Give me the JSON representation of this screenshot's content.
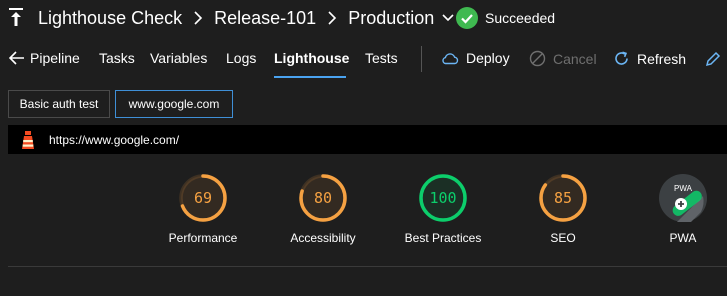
{
  "header": {
    "crumbs": [
      "Lighthouse Check",
      "Release-101",
      "Production"
    ],
    "status": "Succeeded",
    "status_color": "#3fb950"
  },
  "nav": {
    "tabs": [
      {
        "label": "Pipeline",
        "active": false
      },
      {
        "label": "Tasks",
        "active": false
      },
      {
        "label": "Variables",
        "active": false
      },
      {
        "label": "Logs",
        "active": false
      },
      {
        "label": "Lighthouse",
        "active": true
      },
      {
        "label": "Tests",
        "active": false
      }
    ],
    "actions": {
      "deploy": "Deploy",
      "cancel": "Cancel",
      "refresh": "Refresh"
    },
    "accent": "#4aa3f0"
  },
  "subtabs": [
    {
      "label": "Basic auth test",
      "active": false
    },
    {
      "label": "www.google.com",
      "active": true
    }
  ],
  "report": {
    "url": "https://www.google.com/",
    "scores": [
      {
        "label": "Performance",
        "value": "69",
        "fraction": 0.69,
        "color": "#f5a142"
      },
      {
        "label": "Accessibility",
        "value": "80",
        "fraction": 0.8,
        "color": "#f5a142"
      },
      {
        "label": "Best Practices",
        "value": "100",
        "fraction": 1.0,
        "color": "#0cce6b"
      },
      {
        "label": "SEO",
        "value": "85",
        "fraction": 0.85,
        "color": "#f5a142"
      },
      {
        "label": "PWA",
        "value": "",
        "fraction": null,
        "color": "#9aa0a6",
        "badge": "PWA"
      }
    ]
  }
}
